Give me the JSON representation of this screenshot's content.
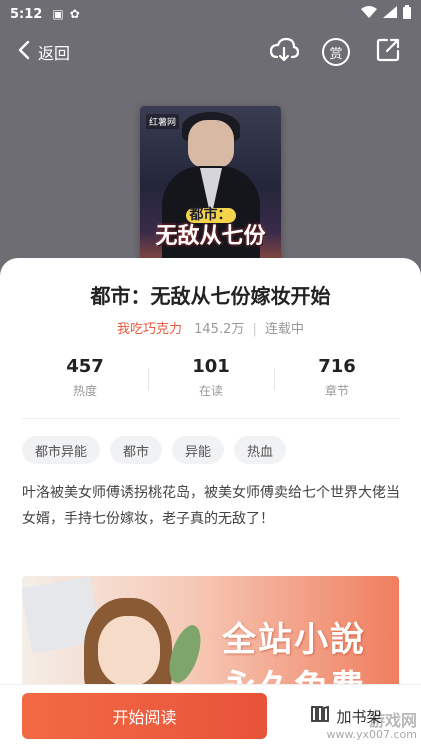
{
  "status_bar": {
    "time": "5:12"
  },
  "header": {
    "back_label": "返回",
    "reward_label": "赏"
  },
  "cover": {
    "badge": "红薯网",
    "title_top": "都市：",
    "title_main": "无敌从七份"
  },
  "book": {
    "title": "都市：无敌从七份嫁妆开始",
    "author": "我吃巧克力",
    "word_count": "145.2万",
    "separator": "|",
    "status": "连载中"
  },
  "stats": [
    {
      "value": "457",
      "label": "热度"
    },
    {
      "value": "101",
      "label": "在读"
    },
    {
      "value": "716",
      "label": "章节"
    }
  ],
  "tags": [
    "都市异能",
    "都市",
    "异能",
    "热血"
  ],
  "description": "叶洛被美女师傅诱拐桃花岛，被美女师傅卖给七个世界大佬当女婿，手持七份嫁妆，老子真的无敌了！",
  "banner": {
    "line1": "全站小說",
    "line2": "永久免费"
  },
  "bottom_bar": {
    "read_label": "开始阅读",
    "shelf_label": "加书架"
  },
  "watermark": {
    "line1": "游戏网",
    "line2": "www.yx007.com"
  },
  "colors": {
    "accent": "#e8593c",
    "header_bg": "#6e6d73"
  }
}
